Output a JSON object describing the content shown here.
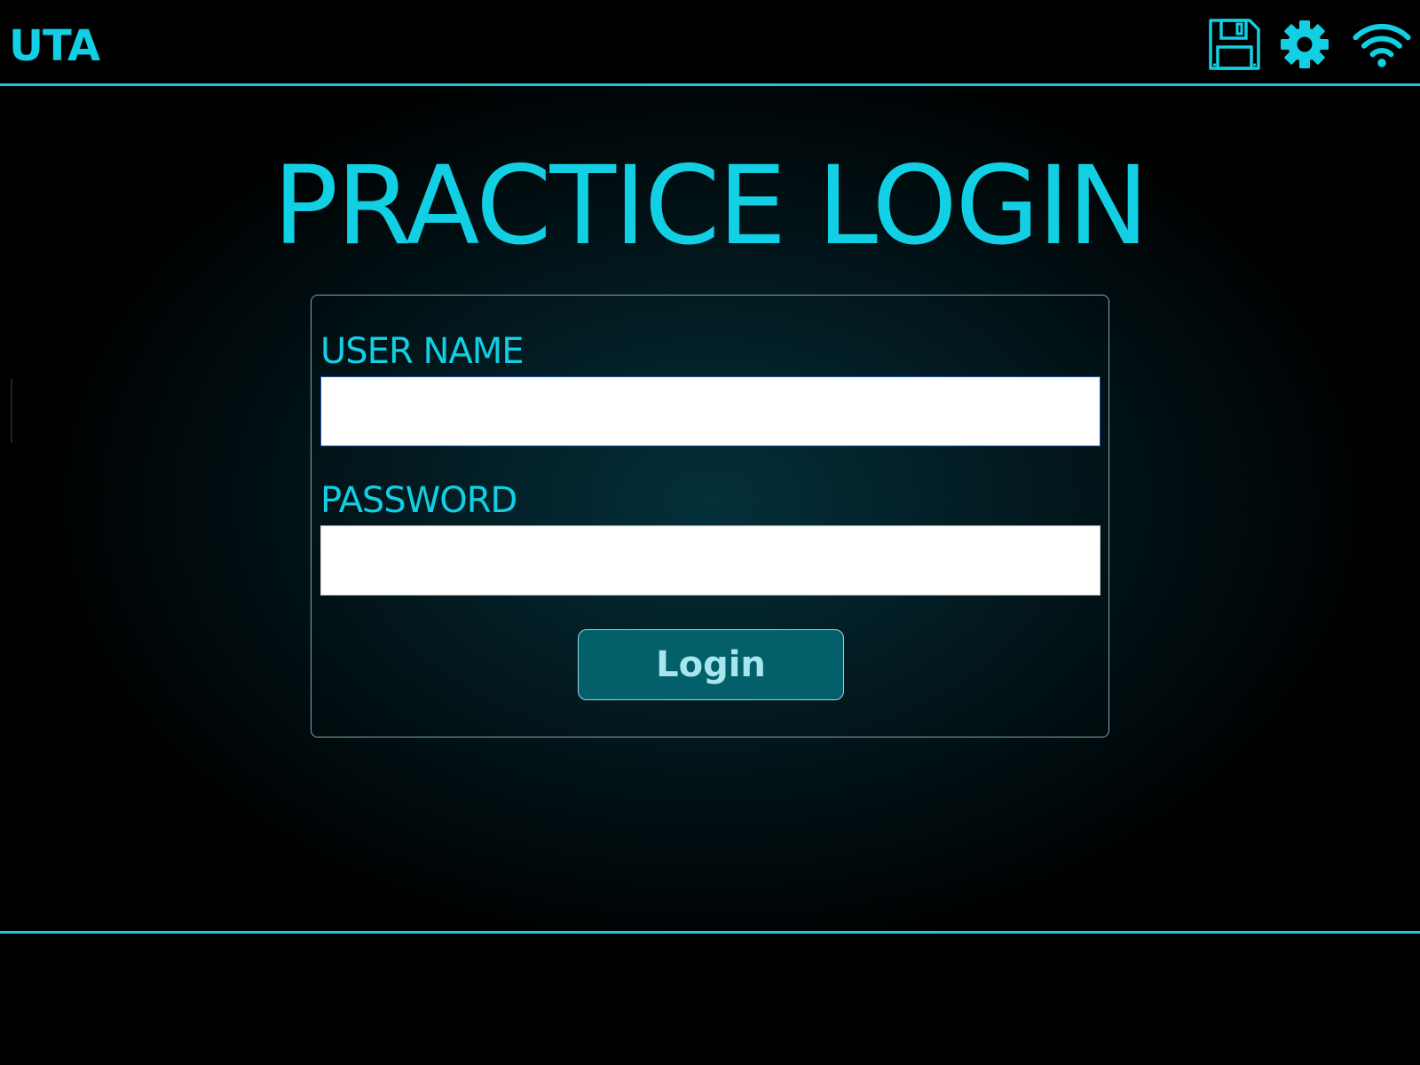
{
  "header": {
    "app_name": "UTA",
    "icons": [
      {
        "name": "save-icon"
      },
      {
        "name": "gear-icon"
      },
      {
        "name": "wifi-icon"
      }
    ]
  },
  "main": {
    "title": "PRACTICE LOGIN",
    "username": {
      "label": "USER NAME",
      "value": "",
      "placeholder": ""
    },
    "password": {
      "label": "PASSWORD",
      "value": "",
      "placeholder": ""
    },
    "login_label": "Login"
  },
  "colors": {
    "accent": "#12cfe3",
    "button_bg": "#03606a",
    "button_text": "#a8e6ee",
    "background": "#000000"
  }
}
